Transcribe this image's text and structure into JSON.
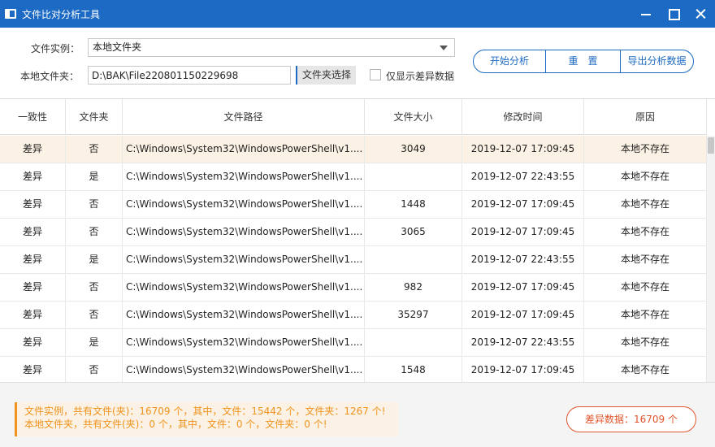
{
  "window": {
    "title": "文件比对分析工具",
    "icon": "app-icon"
  },
  "form": {
    "instance_label": "文件实例：",
    "instance_value": "本地文件夹",
    "folder_label": "本地文件夹：",
    "folder_value": "D:\\BAK\\File220801150229698",
    "browse_label": "文件夹选择",
    "only_diff_label": "仅显示差异数据",
    "only_diff_checked": false
  },
  "actions": {
    "start": "开始分析",
    "reset": "重　置",
    "export": "导出分析数据"
  },
  "table": {
    "headers": [
      "一致性",
      "文件夹",
      "文件路径",
      "文件大小",
      "修改时间",
      "原因"
    ],
    "rows": [
      [
        "差异",
        "否",
        "C:\\Windows\\System32\\WindowsPowerShell\\v1....",
        "3049",
        "2019-12-07 17:09:45",
        "本地不存在"
      ],
      [
        "差异",
        "是",
        "C:\\Windows\\System32\\WindowsPowerShell\\v1....",
        "",
        "2019-12-07 22:43:55",
        "本地不存在"
      ],
      [
        "差异",
        "否",
        "C:\\Windows\\System32\\WindowsPowerShell\\v1....",
        "1448",
        "2019-12-07 17:09:45",
        "本地不存在"
      ],
      [
        "差异",
        "否",
        "C:\\Windows\\System32\\WindowsPowerShell\\v1....",
        "3065",
        "2019-12-07 17:09:45",
        "本地不存在"
      ],
      [
        "差异",
        "是",
        "C:\\Windows\\System32\\WindowsPowerShell\\v1....",
        "",
        "2019-12-07 22:43:55",
        "本地不存在"
      ],
      [
        "差异",
        "否",
        "C:\\Windows\\System32\\WindowsPowerShell\\v1....",
        "982",
        "2019-12-07 17:09:45",
        "本地不存在"
      ],
      [
        "差异",
        "否",
        "C:\\Windows\\System32\\WindowsPowerShell\\v1....",
        "35297",
        "2019-12-07 17:09:45",
        "本地不存在"
      ],
      [
        "差异",
        "是",
        "C:\\Windows\\System32\\WindowsPowerShell\\v1....",
        "",
        "2019-12-07 22:43:55",
        "本地不存在"
      ],
      [
        "差异",
        "否",
        "C:\\Windows\\System32\\WindowsPowerShell\\v1....",
        "1548",
        "2019-12-07 17:09:45",
        "本地不存在"
      ]
    ]
  },
  "footer": {
    "summary_line1": "文件实例，共有文件(夹)：16709 个，其中，文件：15442 个，文件夹：1267 个!",
    "summary_line2": "本地文件夹，共有文件(夹)：0 个，其中，文件：0 个，文件夹：0 个!",
    "diff_count_label": "差异数据：16709 个"
  },
  "colors": {
    "titlebar": "#1c6ac3",
    "accent": "#1c6ac3",
    "summary_text": "#f0931c",
    "summary_bg": "#fbf1e4",
    "diff_button": "#e0542b",
    "selected_row": "#fbf1e4"
  }
}
